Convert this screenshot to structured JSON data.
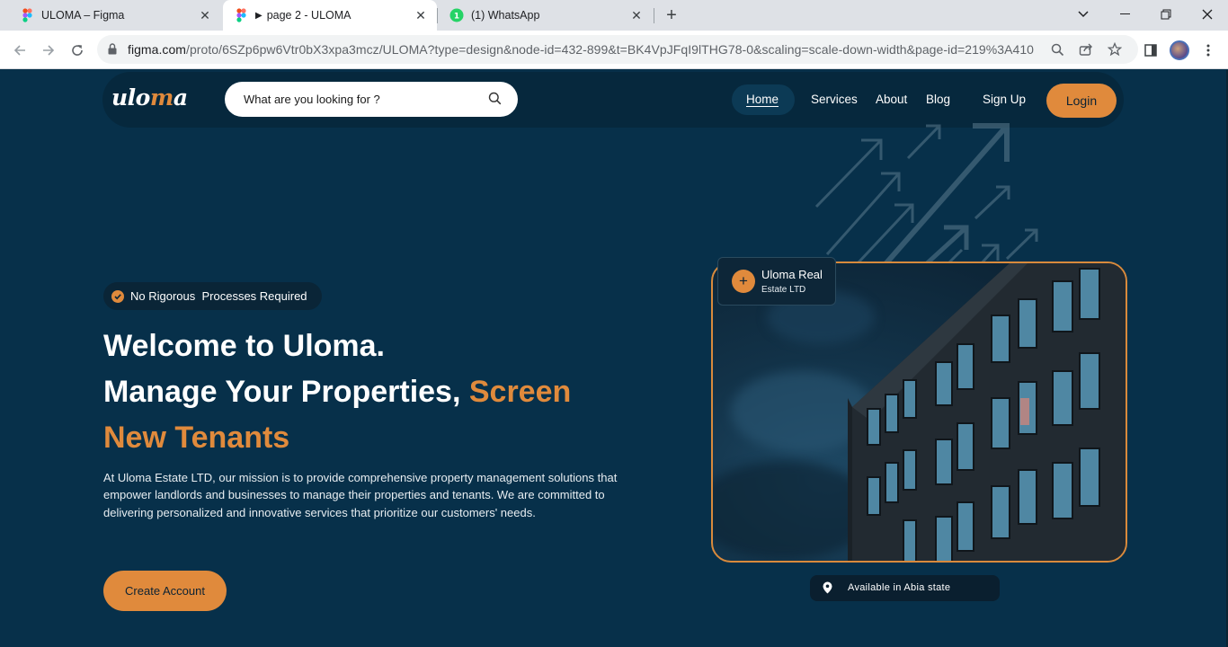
{
  "browser": {
    "tabs": [
      {
        "title": "ULOMA – Figma",
        "icon": "figma-icon"
      },
      {
        "title": "page 2 - ULOMA",
        "icon": "figma-icon",
        "active": true
      },
      {
        "title": "(1) WhatsApp",
        "icon": "whatsapp-icon",
        "badge": "1"
      }
    ],
    "url_host": "figma.com",
    "url_path": "/proto/6SZp6pw6Vtr0bX3xpa3mcz/ULOMA?type=design&node-id=432-899&t=BK4VpJFqI9lTHG78-0&scaling=scale-down-width&page-id=219%3A410"
  },
  "nav": {
    "logo_left": "ulo",
    "logo_mark": "m",
    "logo_right": "a",
    "search_placeholder": "What are you looking for ?",
    "links": {
      "home": "Home",
      "services": "Services",
      "about": "About",
      "blog": "Blog",
      "signup": "Sign Up"
    },
    "login": "Login"
  },
  "hero": {
    "badge": "No Rigorous  Processes Required",
    "heading_line1": "Welcome to Uloma.",
    "heading_line2_white": "Manage Your Properties, ",
    "heading_line2_orange": "Screen",
    "heading_line3_orange": "New Tenants",
    "description": "At Uloma Estate LTD, our mission is to provide comprehensive property management solutions that empower landlords and businesses to manage their properties and tenants. We are committed to delivering personalized and innovative services that prioritize our customers' needs.",
    "cta": "Create Account"
  },
  "card": {
    "title": "Uloma Real",
    "subtitle": "Estate LTD",
    "availability": "Available in Abia state"
  },
  "colors": {
    "page_bg": "#07304a",
    "navbar_bg": "#06283d",
    "accent": "#e08a3c"
  }
}
